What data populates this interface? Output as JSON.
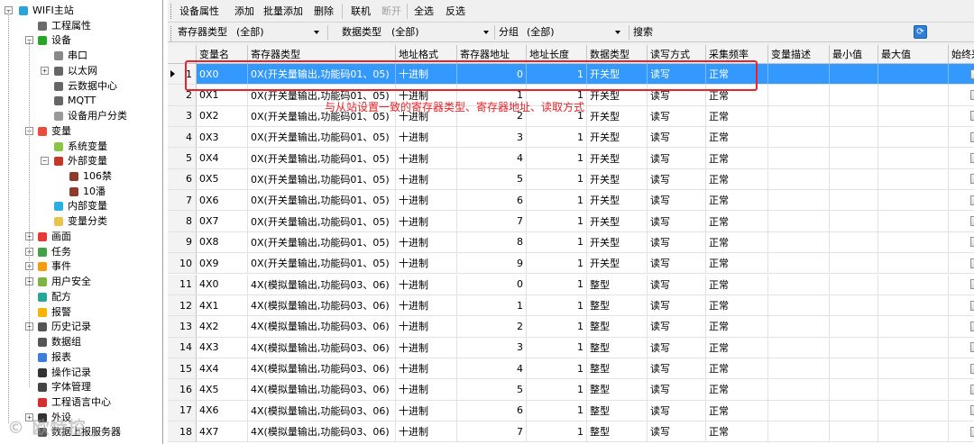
{
  "tree": [
    {
      "label": "WIFI主站",
      "level": 0,
      "expander": "-",
      "icon": "network-icon",
      "color": "#2aa3dc"
    },
    {
      "label": "工程属性",
      "level": 1,
      "expander": "",
      "icon": "properties-icon",
      "color": "#6b6b6b"
    },
    {
      "label": "设备",
      "level": 1,
      "expander": "-",
      "icon": "device-icon",
      "color": "#29a329"
    },
    {
      "label": "串口",
      "level": 2,
      "expander": "",
      "icon": "serial-port-icon",
      "color": "#888888"
    },
    {
      "label": "以太网",
      "level": 2,
      "expander": "+",
      "icon": "ethernet-icon",
      "color": "#666666"
    },
    {
      "label": "云数据中心",
      "level": 2,
      "expander": "",
      "icon": "cloud-icon",
      "color": "#666666"
    },
    {
      "label": "MQTT",
      "level": 2,
      "expander": "",
      "icon": "mqtt-icon",
      "color": "#666666"
    },
    {
      "label": "设备用户分类",
      "level": 2,
      "expander": "",
      "icon": "user-category-icon",
      "color": "#999999"
    },
    {
      "label": "变量",
      "level": 1,
      "expander": "-",
      "icon": "variable-icon",
      "color": "#e84c3d"
    },
    {
      "label": "系统变量",
      "level": 2,
      "expander": "",
      "icon": "system-variable-icon",
      "color": "#8bc34a"
    },
    {
      "label": "外部变量",
      "level": 2,
      "expander": "-",
      "icon": "external-variable-icon",
      "color": "#c0392b"
    },
    {
      "label": "106禁",
      "level": 3,
      "expander": "",
      "icon": "tag-icon",
      "color": "#8e3b2b"
    },
    {
      "label": "10潘",
      "level": 3,
      "expander": "",
      "icon": "tag-icon",
      "color": "#8e3b2b"
    },
    {
      "label": "内部变量",
      "level": 2,
      "expander": "",
      "icon": "internal-variable-icon",
      "color": "#2ab0e0"
    },
    {
      "label": "变量分类",
      "level": 2,
      "expander": "",
      "icon": "folder-icon",
      "color": "#e8c350"
    },
    {
      "label": "画面",
      "level": 1,
      "expander": "+",
      "icon": "screen-icon",
      "color": "#e53935"
    },
    {
      "label": "任务",
      "level": 1,
      "expander": "+",
      "icon": "task-icon",
      "color": "#43a047"
    },
    {
      "label": "事件",
      "level": 1,
      "expander": "+",
      "icon": "event-icon",
      "color": "#f39c12"
    },
    {
      "label": "用户安全",
      "level": 1,
      "expander": "+",
      "icon": "user-security-icon",
      "color": "#7cb342"
    },
    {
      "label": "配方",
      "level": 1,
      "expander": "",
      "icon": "recipe-icon",
      "color": "#26a69a"
    },
    {
      "label": "报警",
      "level": 1,
      "expander": "",
      "icon": "alarm-bell-icon",
      "color": "#f5b400"
    },
    {
      "label": "历史记录",
      "level": 1,
      "expander": "+",
      "icon": "history-icon",
      "color": "#555555"
    },
    {
      "label": "数据组",
      "level": 1,
      "expander": "",
      "icon": "data-group-icon",
      "color": "#555555"
    },
    {
      "label": "报表",
      "level": 1,
      "expander": "",
      "icon": "report-icon",
      "color": "#3b7dd8"
    },
    {
      "label": "操作记录",
      "level": 1,
      "expander": "",
      "icon": "operation-log-icon",
      "color": "#333333"
    },
    {
      "label": "字体管理",
      "level": 1,
      "expander": "",
      "icon": "font-icon",
      "color": "#444444"
    },
    {
      "label": "工程语言中心",
      "level": 1,
      "expander": "",
      "icon": "language-icon",
      "color": "#d32f2f"
    },
    {
      "label": "外设",
      "level": 1,
      "expander": "+",
      "icon": "peripheral-icon",
      "color": "#333333"
    },
    {
      "label": "数据上报服务器",
      "level": 1,
      "expander": "",
      "icon": "upload-server-icon",
      "color": "#555555"
    }
  ],
  "toolbar": [
    {
      "label": "设备属性",
      "name": "device-properties-button",
      "disabled": false
    },
    {
      "label": "添加",
      "name": "add-button",
      "disabled": false
    },
    {
      "label": "批量添加",
      "name": "batch-add-button",
      "disabled": false
    },
    {
      "label": "删除",
      "name": "delete-button",
      "disabled": false
    },
    {
      "label": "联机",
      "name": "connect-button",
      "disabled": false
    },
    {
      "label": "断开",
      "name": "disconnect-button",
      "disabled": true
    },
    {
      "label": "全选",
      "name": "select-all-button",
      "disabled": false
    },
    {
      "label": "反选",
      "name": "invert-selection-button",
      "disabled": false
    }
  ],
  "filters": {
    "register_type_label": "寄存器类型",
    "register_type_value": "(全部)",
    "data_type_label": "数据类型",
    "data_type_value": "(全部)",
    "group_label": "分组",
    "group_value": "(全部)",
    "search_label": "搜索"
  },
  "columns": [
    "变量名",
    "寄存器类型",
    "地址格式",
    "寄存器地址",
    "地址长度",
    "数据类型",
    "读写方式",
    "采集频率",
    "变量描述",
    "最小值",
    "最大值",
    "始终采集"
  ],
  "rows": [
    [
      "0X0",
      "0X(开关量输出,功能码01、05)",
      "十进制",
      "0",
      "1",
      "开关型",
      "读写",
      "正常"
    ],
    [
      "0X1",
      "0X(开关量输出,功能码01、05)",
      "十进制",
      "1",
      "1",
      "开关型",
      "读写",
      "正常"
    ],
    [
      "0X2",
      "0X(开关量输出,功能码01、05)",
      "十进制",
      "2",
      "1",
      "开关型",
      "读写",
      "正常"
    ],
    [
      "0X3",
      "0X(开关量输出,功能码01、05)",
      "十进制",
      "3",
      "1",
      "开关型",
      "读写",
      "正常"
    ],
    [
      "0X4",
      "0X(开关量输出,功能码01、05)",
      "十进制",
      "4",
      "1",
      "开关型",
      "读写",
      "正常"
    ],
    [
      "0X5",
      "0X(开关量输出,功能码01、05)",
      "十进制",
      "5",
      "1",
      "开关型",
      "读写",
      "正常"
    ],
    [
      "0X6",
      "0X(开关量输出,功能码01、05)",
      "十进制",
      "6",
      "1",
      "开关型",
      "读写",
      "正常"
    ],
    [
      "0X7",
      "0X(开关量输出,功能码01、05)",
      "十进制",
      "7",
      "1",
      "开关型",
      "读写",
      "正常"
    ],
    [
      "0X8",
      "0X(开关量输出,功能码01、05)",
      "十进制",
      "8",
      "1",
      "开关型",
      "读写",
      "正常"
    ],
    [
      "0X9",
      "0X(开关量输出,功能码01、05)",
      "十进制",
      "9",
      "1",
      "开关型",
      "读写",
      "正常"
    ],
    [
      "4X0",
      "4X(模拟量输出,功能码03、06)",
      "十进制",
      "0",
      "1",
      "整型",
      "读写",
      "正常"
    ],
    [
      "4X1",
      "4X(模拟量输出,功能码03、06)",
      "十进制",
      "1",
      "1",
      "整型",
      "读写",
      "正常"
    ],
    [
      "4X2",
      "4X(模拟量输出,功能码03、06)",
      "十进制",
      "2",
      "1",
      "整型",
      "读写",
      "正常"
    ],
    [
      "4X3",
      "4X(模拟量输出,功能码03、06)",
      "十进制",
      "3",
      "1",
      "整型",
      "读写",
      "正常"
    ],
    [
      "4X4",
      "4X(模拟量输出,功能码03、06)",
      "十进制",
      "4",
      "1",
      "整型",
      "读写",
      "正常"
    ],
    [
      "4X5",
      "4X(模拟量输出,功能码03、06)",
      "十进制",
      "5",
      "1",
      "整型",
      "读写",
      "正常"
    ],
    [
      "4X6",
      "4X(模拟量输出,功能码03、06)",
      "十进制",
      "6",
      "1",
      "整型",
      "读写",
      "正常"
    ],
    [
      "4X7",
      "4X(模拟量输出,功能码03、06)",
      "十进制",
      "7",
      "1",
      "整型",
      "读写",
      "正常"
    ]
  ],
  "selected_row": 1,
  "annotation": "与从站设置一致的寄存器类型、寄存器地址、读取方式",
  "watermark": "© 欧特控",
  "colors": {
    "selection": "#3399ff",
    "annotation": "#e8232a"
  }
}
